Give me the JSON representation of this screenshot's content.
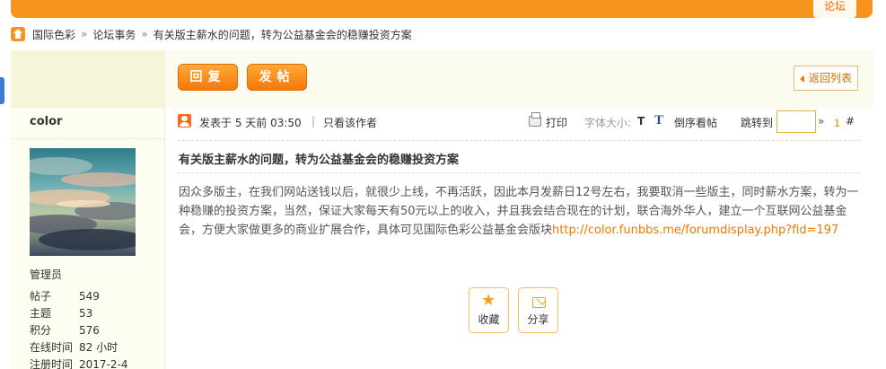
{
  "top_tab": "论坛",
  "breadcrumb": {
    "home_icon": "home-icon",
    "items": [
      "国际色彩",
      "论坛事务",
      "有关版主薪水的问题，转为公益基金会的稳赚投资方案"
    ],
    "separator": "»"
  },
  "toolbar": {
    "reply_label": "回复",
    "post_label": "发帖",
    "back_label": "返回列表"
  },
  "user": {
    "name": "color",
    "group": "管理员",
    "stats": [
      {
        "label": "帖子",
        "value": "549"
      },
      {
        "label": "主题",
        "value": "53"
      },
      {
        "label": "积分",
        "value": "576"
      },
      {
        "label": "在线时间",
        "value": "82 小时"
      },
      {
        "label": "注册时间",
        "value": "2017-2-4"
      }
    ]
  },
  "post": {
    "meta_posted": "发表于 5 天前 03:50",
    "meta_sep": "|",
    "only_author": "只看该作者",
    "print": "打印",
    "font_size_label": "字体大小:",
    "font_size_t": "T",
    "reverse_icon": "T",
    "reverse_label": "倒序看帖",
    "jump_label": "跳转到",
    "jump_value": "",
    "jump_arrow": "»",
    "floor_number": "1",
    "floor_hash": "#",
    "title": "有关版主薪水的问题，转为公益基金会的稳赚投资方案",
    "body": "因众多版主，在我们网站送钱以后，就很少上线，不再活跃，因此本月发薪日12号左右，我要取消一些版主，同时薪水方案，转为一种稳赚的投资方案，当然，保证大家每天有50元以上的收入，并且我会结合现在的计划，联合海外华人，建立一个互联网公益基金会，方便大家做更多的商业扩展合作，具体可见国际色彩公益基金会版块",
    "link": "http://color.funbbs.me/forumdisplay.php?fid=197"
  },
  "actions": {
    "favorite_label": "收藏",
    "share_label": "分享"
  },
  "colors": {
    "accent": "#f7941d",
    "link": "#f07800",
    "sidebar_bg": "#fdfdf1"
  }
}
